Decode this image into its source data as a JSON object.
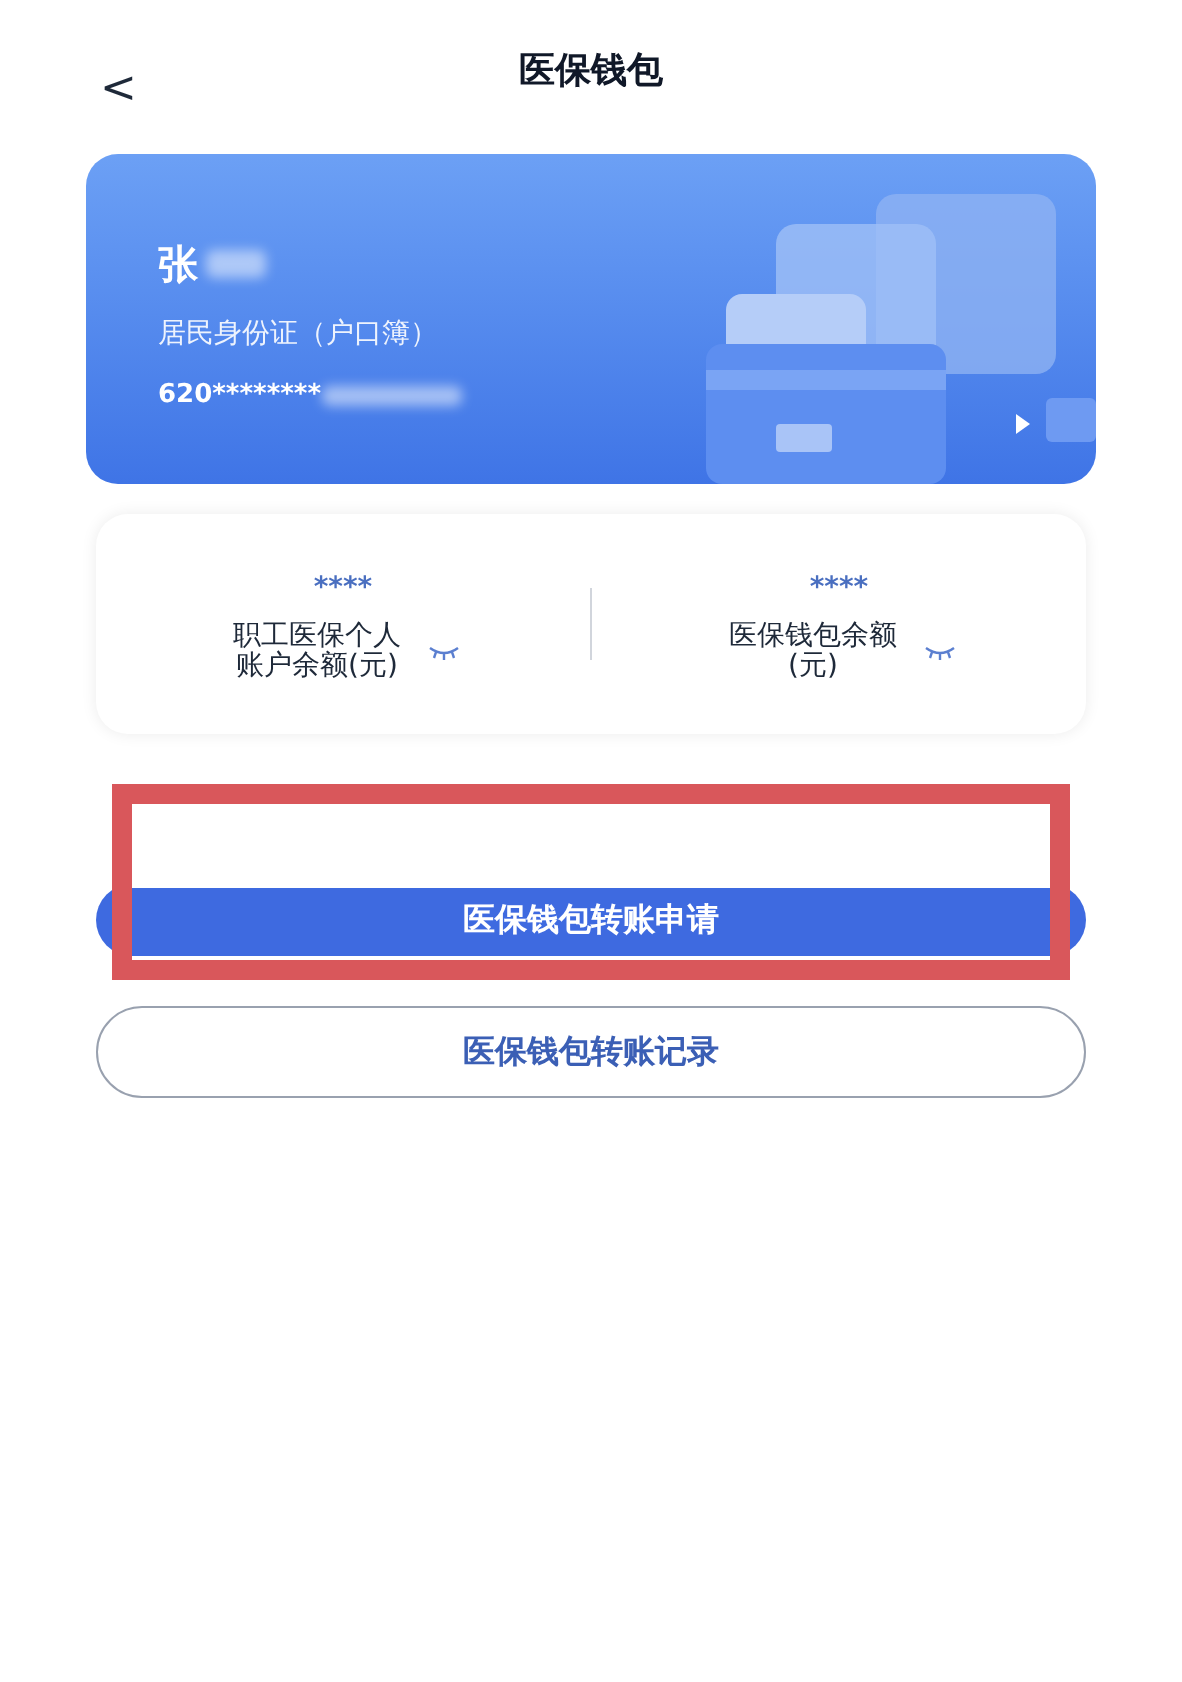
{
  "header": {
    "back": "<",
    "title": "医保钱包"
  },
  "card": {
    "name": "张",
    "id_type": "居民身份证（户口簿）",
    "id_number": "620********",
    "name_redacted": true,
    "id_redacted": true
  },
  "balances": [
    {
      "value": "****",
      "label": "职工医保个人账户余额(元)",
      "hidden": true
    },
    {
      "value": "****",
      "label": "医保钱包余额(元)",
      "hidden": true
    }
  ],
  "buttons": [
    {
      "label": "医保钱包转账申请",
      "kind": "primary",
      "highlighted": true
    },
    {
      "label": "医保钱包转账记录",
      "kind": "outline",
      "highlighted": false
    }
  ]
}
